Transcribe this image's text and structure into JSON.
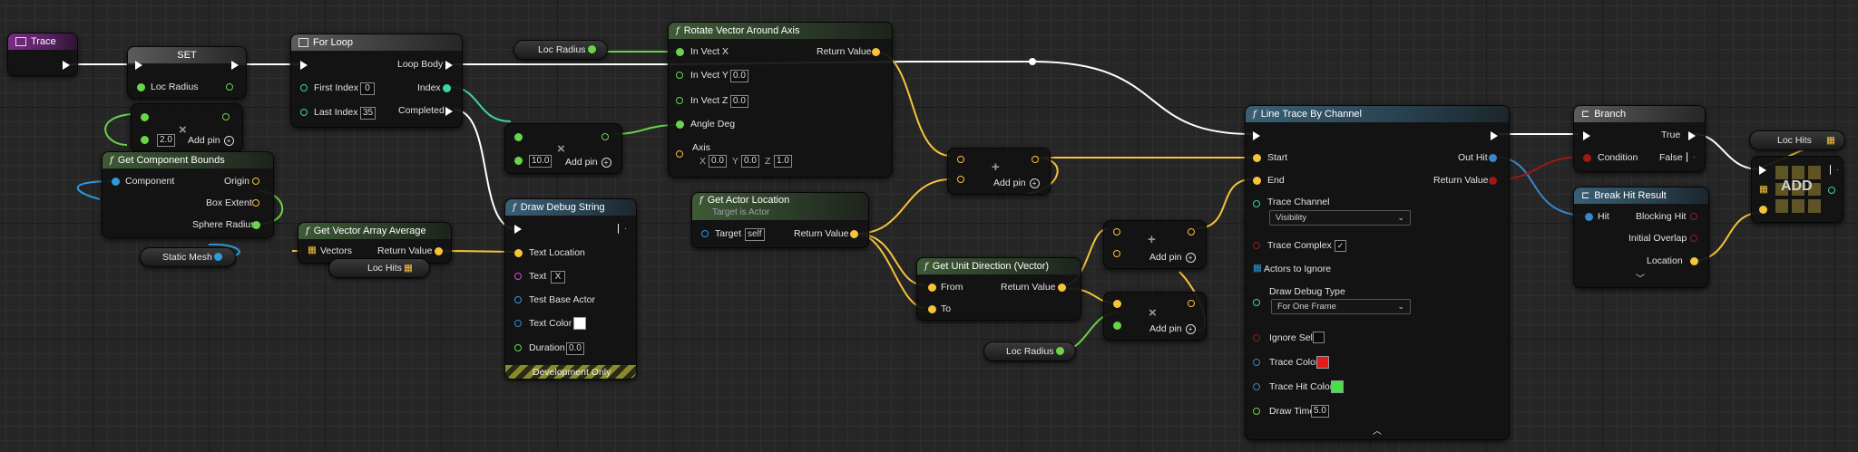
{
  "colors": {
    "exec": "#ffffff",
    "vector": "#f7c33b",
    "float": "#6ad44a",
    "int": "#3bd6a3",
    "object": "#2e9bdb",
    "string": "#df46d8",
    "bool": "#9a1a1a",
    "struct": "#3a86c8",
    "color": "#e51a1a",
    "hitcolor": "#48e048"
  },
  "trace_event": {
    "title": "Trace"
  },
  "set_node": {
    "title": "SET",
    "var": "Loc Radius"
  },
  "mult1": {
    "value": "2.0",
    "addpin": "Add pin"
  },
  "component_bounds": {
    "title": "Get Component Bounds",
    "component": "Component",
    "origin": "Origin",
    "box_extent": "Box Extent",
    "sphere_radius": "Sphere Radius"
  },
  "static_mesh": {
    "label": "Static Mesh"
  },
  "for_loop": {
    "title": "For Loop",
    "loop_body": "Loop Body",
    "first_index": "First Index",
    "first_val": "0",
    "index": "Index",
    "last_index": "Last Index",
    "last_val": "35",
    "completed": "Completed"
  },
  "vec_avg": {
    "title": "Get Vector Array Average",
    "vectors": "Vectors",
    "return": "Return Value"
  },
  "loc_hits_get1": {
    "label": "Loc Hits"
  },
  "loc_radius_get1": {
    "label": "Loc Radius"
  },
  "mult2": {
    "value": "10.0",
    "addpin": "Add pin"
  },
  "rotate": {
    "title": "Rotate Vector Around Axis",
    "in_x": "In Vect X",
    "in_y": "In Vect Y",
    "in_y_val": "0.0",
    "in_z": "In Vect Z",
    "in_z_val": "0.0",
    "angle": "Angle Deg",
    "axis": "Axis",
    "ax_x": "X",
    "ax_x_val": "0.0",
    "ax_y": "Y",
    "ax_y_val": "0.0",
    "ax_z": "Z",
    "ax_z_val": "1.0",
    "return": "Return Value"
  },
  "debug_string": {
    "title": "Draw Debug String",
    "text_location": "Text Location",
    "text": "Text",
    "text_val": "X",
    "base_actor": "Test Base Actor",
    "text_color": "Text Color",
    "duration": "Duration",
    "duration_val": "0.0",
    "footer": "Development Only"
  },
  "actor_location": {
    "title": "Get Actor Location",
    "subtitle": "Target is Actor",
    "target": "Target",
    "target_val": "self",
    "return": "Return Value"
  },
  "unit_dir": {
    "title": "Get Unit Direction (Vector)",
    "from": "From",
    "to": "To",
    "return": "Return Value"
  },
  "add1": {
    "addpin": "Add pin"
  },
  "add2": {
    "addpin": "Add pin"
  },
  "mult3": {
    "addpin": "Add pin"
  },
  "loc_radius_get2": {
    "label": "Loc Radius"
  },
  "line_trace": {
    "title": "Line Trace By Channel",
    "start": "Start",
    "end": "End",
    "out_hit": "Out Hit",
    "return": "Return Value",
    "trace_channel": "Trace Channel",
    "trace_channel_val": "Visibility",
    "trace_complex": "Trace Complex",
    "actors_ignore": "Actors to Ignore",
    "draw_debug": "Draw Debug Type",
    "draw_debug_val": "For One Frame",
    "ignore_self": "Ignore Self",
    "trace_color": "Trace Color",
    "trace_hit_color": "Trace Hit Color",
    "draw_time": "Draw Time",
    "draw_time_val": "5.0"
  },
  "branch": {
    "title": "Branch",
    "condition": "Condition",
    "true": "True",
    "false": "False"
  },
  "break_hit": {
    "title": "Break Hit Result",
    "hit": "Hit",
    "blocking": "Blocking Hit",
    "initial_overlap": "Initial Overlap",
    "location": "Location"
  },
  "loc_hits_get2": {
    "label": "Loc Hits"
  },
  "add_array": {
    "label": "ADD"
  }
}
